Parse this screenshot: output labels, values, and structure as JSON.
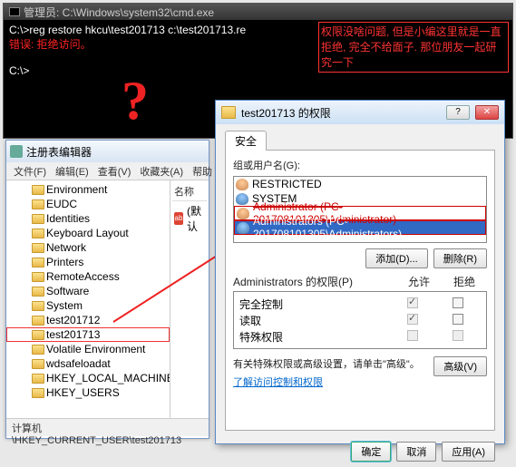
{
  "cmd": {
    "title": "管理员: C:\\Windows\\system32\\cmd.exe",
    "line1": "C:\\>reg restore hkcu\\test201713 c:\\test201713.re",
    "line2_label": "错误:",
    "line2_msg": " 拒绝访问。",
    "prompt": "C:\\>",
    "annotation": "权限没啥问题, 但是小编这里就是一直拒绝, 完全不给面子. 那位朋友一起研究一下",
    "qmark": "?"
  },
  "reg": {
    "title": "注册表编辑器",
    "menu": [
      "文件(F)",
      "编辑(E)",
      "查看(V)",
      "收藏夹(A)",
      "帮助"
    ],
    "tree": [
      "Environment",
      "EUDC",
      "Identities",
      "Keyboard Layout",
      "Network",
      "Printers",
      "RemoteAccess",
      "Software",
      "System",
      "test201712",
      "test201713",
      "Volatile Environment",
      "wdsafeloadat",
      "HKEY_LOCAL_MACHINE",
      "HKEY_USERS"
    ],
    "selected_index": 10,
    "rpane_header": "名称",
    "rpane_default_icon": "ab",
    "rpane_default": "(默认",
    "status": "计算机\\HKEY_CURRENT_USER\\test201713"
  },
  "perm": {
    "title": "test201713 的权限",
    "tab": "安全",
    "group_label": "组或用户名(G):",
    "users": [
      {
        "name": "RESTRICTED",
        "strike": false,
        "sel": false,
        "group": false
      },
      {
        "name": "SYSTEM",
        "strike": false,
        "sel": false,
        "group": true
      },
      {
        "name": "Administrator (PC-201708101305\\Administrator)",
        "strike": true,
        "sel": false,
        "group": false
      },
      {
        "name": "Administrators (PC-201708101305\\Administrators)",
        "strike": false,
        "sel": true,
        "group": true
      }
    ],
    "add_btn": "添加(D)...",
    "remove_btn": "删除(R)",
    "perm_label_prefix": "Administrators",
    "perm_label_suffix": " 的权限(P)",
    "allow_hdr": "允许",
    "deny_hdr": "拒绝",
    "rows": [
      {
        "name": "完全控制",
        "allow": true,
        "deny": false,
        "allow_dis": true,
        "deny_dis": false
      },
      {
        "name": "读取",
        "allow": true,
        "deny": false,
        "allow_dis": true,
        "deny_dis": false
      },
      {
        "name": "特殊权限",
        "allow": false,
        "deny": false,
        "allow_dis": true,
        "deny_dis": true
      }
    ],
    "note": "有关特殊权限或高级设置，请单击\"高级\"。",
    "adv_btn": "高级(V)",
    "link": "了解访问控制和权限",
    "ok": "确定",
    "cancel": "取消",
    "apply": "应用(A)"
  }
}
